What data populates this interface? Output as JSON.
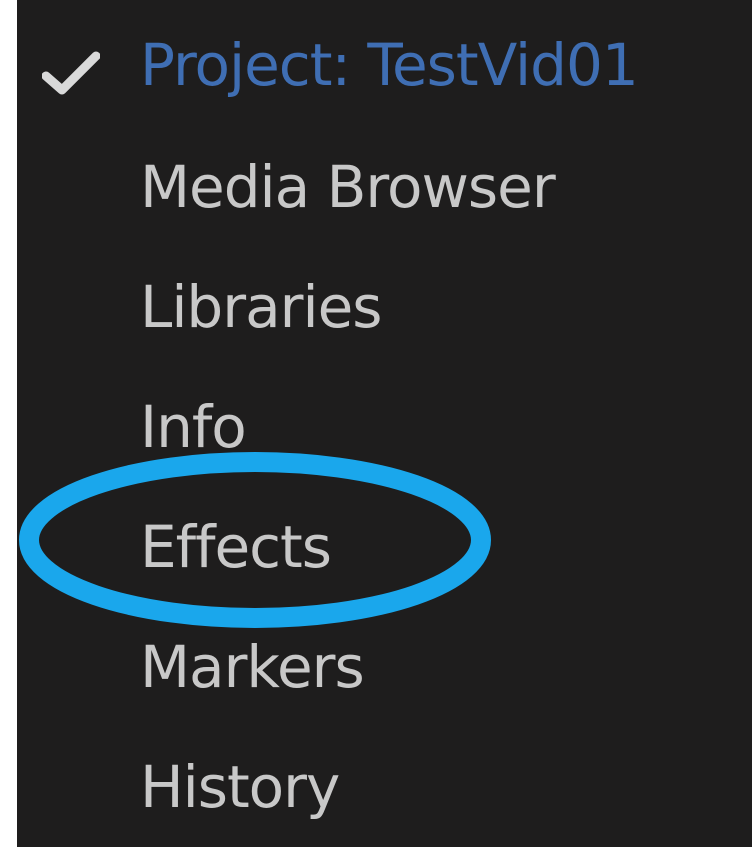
{
  "menu": {
    "items": [
      {
        "label": "Project: TestVid01",
        "checked": true
      },
      {
        "label": "Media Browser",
        "checked": false
      },
      {
        "label": "Libraries",
        "checked": false
      },
      {
        "label": "Info",
        "checked": false
      },
      {
        "label": "Effects",
        "checked": false
      },
      {
        "label": "Markers",
        "checked": false
      },
      {
        "label": "History",
        "checked": false
      }
    ]
  },
  "colors": {
    "background": "#1e1d1d",
    "text": "#c8c8c8",
    "active_text": "#3f6eb3",
    "check": "#d9d9d9",
    "highlight_ellipse": "#1aa7ec"
  },
  "icons": {
    "check": "checkmark-icon"
  }
}
